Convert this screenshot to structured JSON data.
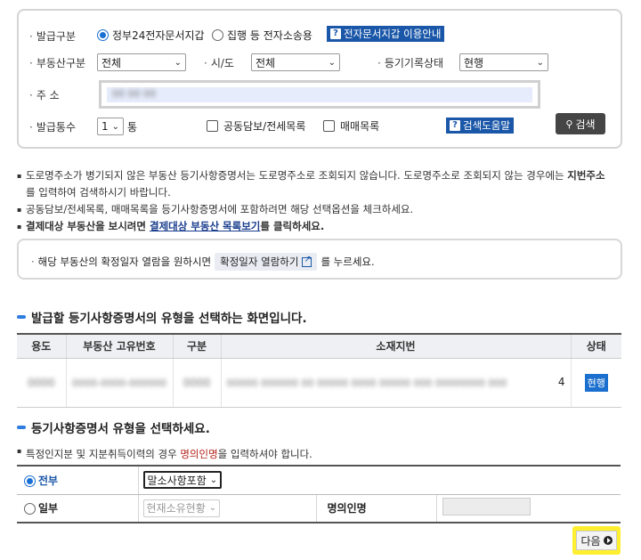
{
  "search": {
    "issue_type_label": "발급구분",
    "issue_type_options": [
      "정부24전자문서지갑",
      "집행 등 전자소송용"
    ],
    "e_wallet_guide": "전자문서지갑 이용안내",
    "property_type_label": "부동산구분",
    "property_type_value": "전체",
    "city_label": "시/도",
    "city_value": "전체",
    "registry_status_label": "등기기록상태",
    "registry_status_value": "현행",
    "address_label": "주 소",
    "address_value": "00 00 00",
    "count_label": "발급통수",
    "count_value": "1",
    "count_unit": "통",
    "joint_collateral_label": "공동담보/전세목록",
    "sales_list_label": "매매목록",
    "search_help": "검색도움말",
    "search_button": "검색"
  },
  "notes": {
    "line1a": "도로명주소가 병기되지 않은 부동산 등기사항증명서는 도로명주소로 조회되지 않습니다. 도로명주소로 조회되지 않는 경우에는 ",
    "line1b": "지번주소",
    "line1c": "를 입력하여 검색하시기 바랍니다.",
    "line2": "공동담보/전세목록, 매매목록을 등기사항증명서에 포함하려면 해당 선택옵션을 체크하세요.",
    "line3a": "결제대상 부동산을 보시려면 ",
    "line3_link": "결제대상 부동산 목록보기",
    "line3c": "를 클릭하세요."
  },
  "callout": {
    "text_before": "해당 부동산의 확정일자 열람을 원하시면",
    "button": "확정일자 열람하기",
    "text_after": "를 누르세요."
  },
  "section1": {
    "title": "발급할 등기사항증명서의 유형을 선택하는 화면입니다.",
    "columns": [
      "용도",
      "부동산 고유번호",
      "구분",
      "소재지번",
      "상태"
    ],
    "row": {
      "use": "0000",
      "unique_no": "0000-0000-000000",
      "kind": "0000",
      "address": "00000 000000 00 00000 0000 00000 000 00000000 000",
      "address_tail": "4",
      "status": "현행"
    }
  },
  "section2": {
    "title": "등기사항증명서 유형을 선택하세요.",
    "hint_a": "특정인지분 및 지분취득이력의 경우 ",
    "hint_red": "명의인명",
    "hint_b": "을 입력하셔야 합니다.",
    "full_label": "전부",
    "full_select": "말소사항포함",
    "partial_label": "일부",
    "partial_select": "현재소유현황",
    "owner_name_label": "명의인명",
    "owner_name_value": ""
  },
  "next_button": "다음",
  "colors": {
    "accent": "#1b57a8",
    "highlight": "#ffef2e",
    "badge": "#1b6fce"
  }
}
